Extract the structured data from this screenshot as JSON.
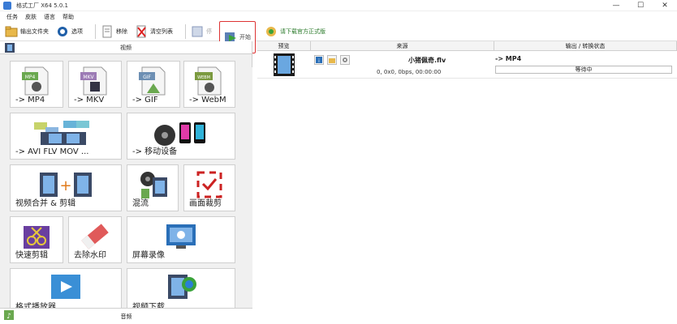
{
  "window": {
    "title": "格式工厂 X64 5.0.1",
    "minimize": "—",
    "maximize": "☐",
    "close": "✕"
  },
  "menu": [
    "任务",
    "皮肤",
    "语言",
    "帮助"
  ],
  "toolbar": {
    "output_folder": "输出文件夹",
    "options": "选项",
    "remove": "移除",
    "clear_list": "清空列表",
    "stop": "停",
    "start": "开始",
    "download": "请下载官方正式版"
  },
  "left": {
    "category_video": "视频",
    "category_audio": "音频",
    "tiles": [
      {
        "label": "-> MP4",
        "icon": "mp4-file-icon",
        "badge": "MP4",
        "color": "#6aa84f"
      },
      {
        "label": "-> MKV",
        "icon": "mkv-file-icon",
        "badge": "MKV",
        "color": "#9c7bb5"
      },
      {
        "label": "-> GIF",
        "icon": "gif-file-icon",
        "badge": "GIF",
        "color": "#6d8fb3"
      },
      {
        "label": "-> WebM",
        "icon": "webm-file-icon",
        "badge": "WEBM",
        "color": "#7b9a3f"
      },
      {
        "label": "-> AVI FLV MOV ...",
        "icon": "multi-format-icon"
      },
      {
        "label": "-> 移动设备",
        "icon": "mobile-device-icon"
      },
      {
        "label": "视频合并 & 剪辑",
        "icon": "video-merge-icon"
      },
      {
        "label": "混流",
        "icon": "mux-icon"
      },
      {
        "label": "画面裁剪",
        "icon": "crop-icon"
      },
      {
        "label": "快速剪辑",
        "icon": "quick-cut-icon"
      },
      {
        "label": "去除水印",
        "icon": "remove-watermark-icon"
      },
      {
        "label": "屏幕录像",
        "icon": "screen-record-icon"
      },
      {
        "label": "格式播放器",
        "icon": "player-icon"
      },
      {
        "label": "视频下载",
        "icon": "video-download-icon"
      }
    ]
  },
  "table": {
    "headers": {
      "preview": "预览",
      "source": "来源",
      "output": "输出 / 转换状态"
    },
    "rows": [
      {
        "filename": "小猪佩奇.flv",
        "info": "0, 0x0, 0bps, 00:00:00",
        "output": "-> MP4",
        "status": "等待中"
      }
    ]
  }
}
